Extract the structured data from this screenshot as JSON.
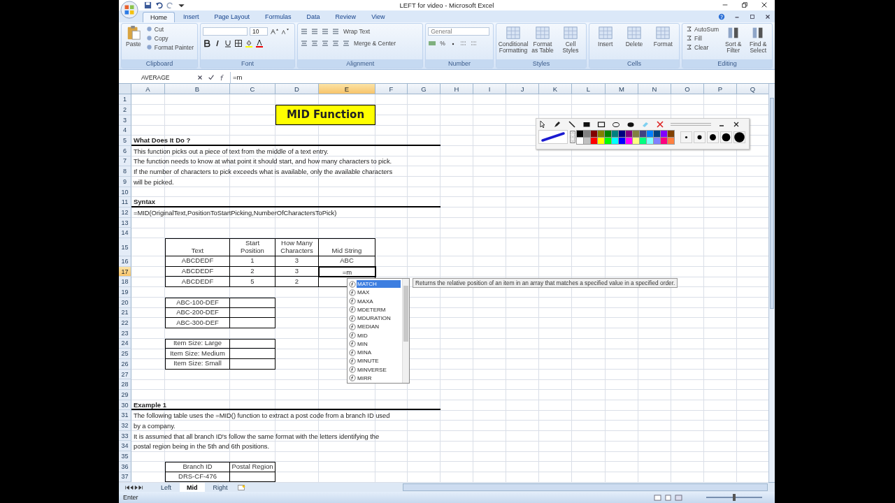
{
  "window": {
    "title": "LEFT for video - Microsoft Excel"
  },
  "ribbon": {
    "tabs": [
      {
        "label": "Home",
        "selected": true
      },
      {
        "label": "Insert",
        "selected": false
      },
      {
        "label": "Page Layout",
        "selected": false
      },
      {
        "label": "Formulas",
        "selected": false
      },
      {
        "label": "Data",
        "selected": false
      },
      {
        "label": "Review",
        "selected": false
      },
      {
        "label": "View",
        "selected": false
      }
    ],
    "groups": [
      {
        "kind": "clipboard",
        "name": "Clipboard",
        "paste": "Paste",
        "items": [
          "Cut",
          "Copy",
          "Format Painter"
        ]
      },
      {
        "kind": "font",
        "name": "Font",
        "size": "10"
      },
      {
        "kind": "alignment",
        "name": "Alignment",
        "items": [
          "Wrap Text",
          "Merge & Center"
        ]
      },
      {
        "kind": "number",
        "name": "Number",
        "format": "General",
        "percent": "%"
      },
      {
        "kind": "large",
        "name": "Styles",
        "items": [
          "Conditional Formatting",
          "Format as Table",
          "Cell Styles"
        ]
      },
      {
        "kind": "large",
        "name": "Cells",
        "items": [
          "Insert",
          "Delete",
          "Format"
        ]
      },
      {
        "kind": "editing",
        "name": "Editing",
        "items": [
          "AutoSum",
          "Fill",
          "Clear"
        ],
        "large": [
          "Sort & Filter",
          "Find & Select"
        ]
      }
    ]
  },
  "formula_bar": {
    "name_box": "AVERAGE",
    "formula": "=m"
  },
  "sheet": {
    "columns": [
      {
        "label": "A",
        "selected": false
      },
      {
        "label": "B",
        "selected": false
      },
      {
        "label": "C",
        "selected": false
      },
      {
        "label": "D",
        "selected": false
      },
      {
        "label": "E",
        "selected": true
      },
      {
        "label": "F",
        "selected": false
      },
      {
        "label": "G",
        "selected": false
      },
      {
        "label": "H",
        "selected": false
      },
      {
        "label": "I",
        "selected": false
      },
      {
        "label": "J",
        "selected": false
      },
      {
        "label": "K",
        "selected": false
      },
      {
        "label": "L",
        "selected": false
      },
      {
        "label": "M",
        "selected": false
      },
      {
        "label": "N",
        "selected": false
      },
      {
        "label": "O",
        "selected": false
      },
      {
        "label": "P",
        "selected": false
      },
      {
        "label": "Q",
        "selected": false
      }
    ],
    "rows": [
      {
        "label": "1",
        "selected": false
      },
      {
        "label": "2",
        "selected": false
      },
      {
        "label": "3",
        "selected": false
      },
      {
        "label": "4",
        "selected": false
      },
      {
        "label": "5",
        "selected": false
      },
      {
        "label": "6",
        "selected": false
      },
      {
        "label": "7",
        "selected": false
      },
      {
        "label": "8",
        "selected": false
      },
      {
        "label": "9",
        "selected": false
      },
      {
        "label": "10",
        "selected": false
      },
      {
        "label": "11",
        "selected": false
      },
      {
        "label": "12",
        "selected": false
      },
      {
        "label": "13",
        "selected": false
      },
      {
        "label": "14",
        "selected": false
      },
      {
        "label": "15",
        "selected": false
      },
      {
        "label": "16",
        "selected": false
      },
      {
        "label": "17",
        "selected": true
      },
      {
        "label": "18",
        "selected": false
      },
      {
        "label": "19",
        "selected": false
      },
      {
        "label": "20",
        "selected": false
      },
      {
        "label": "21",
        "selected": false
      },
      {
        "label": "22",
        "selected": false
      },
      {
        "label": "23",
        "selected": false
      },
      {
        "label": "24",
        "selected": false
      },
      {
        "label": "25",
        "selected": false
      },
      {
        "label": "26",
        "selected": false
      },
      {
        "label": "27",
        "selected": false
      },
      {
        "label": "28",
        "selected": false
      },
      {
        "label": "29",
        "selected": false
      },
      {
        "label": "30",
        "selected": false
      },
      {
        "label": "31",
        "selected": false
      },
      {
        "label": "32",
        "selected": false
      },
      {
        "label": "33",
        "selected": false
      },
      {
        "label": "34",
        "selected": false
      },
      {
        "label": "35",
        "selected": false
      },
      {
        "label": "36",
        "selected": false
      },
      {
        "label": "37",
        "selected": false
      }
    ],
    "title": "MID Function",
    "sections": [
      {
        "heading": "What Does It Do ?",
        "lines": [
          "This function picks out a piece of text from the middle of a text entry.",
          "The function needs to know at what point it should start, and how many characters to pick.",
          "If the number of characters to pick exceeds what is available, only the available characters",
          "will be picked."
        ]
      },
      {
        "heading": "Syntax",
        "lines": [
          "=MID(OriginalText,PositionToStartPicking,NumberOfCharactersToPick)"
        ]
      },
      {
        "heading": "Example 1",
        "lines": [
          "The following table uses the =MID() function to extract a post code from a branch ID used",
          "by a company.",
          "It is assumed that all branch ID's follow the same format with the letters identifying the",
          "postal region being in the 5th and 6th positions."
        ]
      }
    ],
    "tables": [
      {
        "header": [
          "Text",
          "Start Position",
          "How Many Characters",
          "Mid String"
        ],
        "rows": [
          [
            "ABCDEDF",
            "1",
            "3",
            "ABC"
          ],
          [
            "ABCDEDF",
            "2",
            "3"
          ],
          [
            "ABCDEDF",
            "5",
            "2"
          ]
        ]
      },
      {
        "rows": [
          [
            "ABC-100-DEF"
          ],
          [
            "ABC-200-DEF"
          ],
          [
            "ABC-300-DEF"
          ]
        ]
      },
      {
        "rows": [
          [
            "Item Size: Large"
          ],
          [
            "Item Size: Medium"
          ],
          [
            "Item Size: Small"
          ]
        ]
      },
      {
        "header": [
          "Branch ID",
          "Postal Region"
        ],
        "rows": [
          [
            "DRS-CF-476"
          ]
        ]
      }
    ],
    "active_cell": {
      "value": "=m"
    }
  },
  "autocomplete": {
    "items": [
      {
        "label": "MATCH",
        "selected": true
      },
      {
        "label": "MAX",
        "selected": false
      },
      {
        "label": "MAXA",
        "selected": false
      },
      {
        "label": "MDETERM",
        "selected": false
      },
      {
        "label": "MDURATION",
        "selected": false
      },
      {
        "label": "MEDIAN",
        "selected": false
      },
      {
        "label": "MID",
        "selected": false
      },
      {
        "label": "MIN",
        "selected": false
      },
      {
        "label": "MINA",
        "selected": false
      },
      {
        "label": "MINUTE",
        "selected": false
      },
      {
        "label": "MINVERSE",
        "selected": false
      },
      {
        "label": "MIRR",
        "selected": false
      }
    ],
    "tooltip": "Returns the relative position of an item in an array that matches a specified value in a specified order."
  },
  "drawing_toolbar": {
    "palette": [
      {
        "color": "#000000"
      },
      {
        "color": "#808080"
      },
      {
        "color": "#800000"
      },
      {
        "color": "#808000"
      },
      {
        "color": "#008000"
      },
      {
        "color": "#008080"
      },
      {
        "color": "#000080"
      },
      {
        "color": "#800080"
      },
      {
        "color": "#808040"
      },
      {
        "color": "#404080"
      },
      {
        "color": "#0080ff"
      },
      {
        "color": "#004080"
      },
      {
        "color": "#8000ff"
      },
      {
        "color": "#804000"
      },
      {
        "color": "#ffffff"
      },
      {
        "color": "#c0c0c0"
      },
      {
        "color": "#ff0000"
      },
      {
        "color": "#ffff00"
      },
      {
        "color": "#00ff00"
      },
      {
        "color": "#00ffff"
      },
      {
        "color": "#0000ff"
      },
      {
        "color": "#ff00ff"
      },
      {
        "color": "#ffff80"
      },
      {
        "color": "#00ff80"
      },
      {
        "color": "#80ffff"
      },
      {
        "color": "#8080ff"
      },
      {
        "color": "#ff0080"
      },
      {
        "color": "#ff8040"
      }
    ]
  },
  "sheet_tabs": [
    {
      "label": "Left",
      "selected": false
    },
    {
      "label": "Mid",
      "selected": true
    },
    {
      "label": "Right",
      "selected": false
    }
  ],
  "status_bar": {
    "mode": "Enter",
    "zoom": {
      "level": 0.5
    }
  }
}
